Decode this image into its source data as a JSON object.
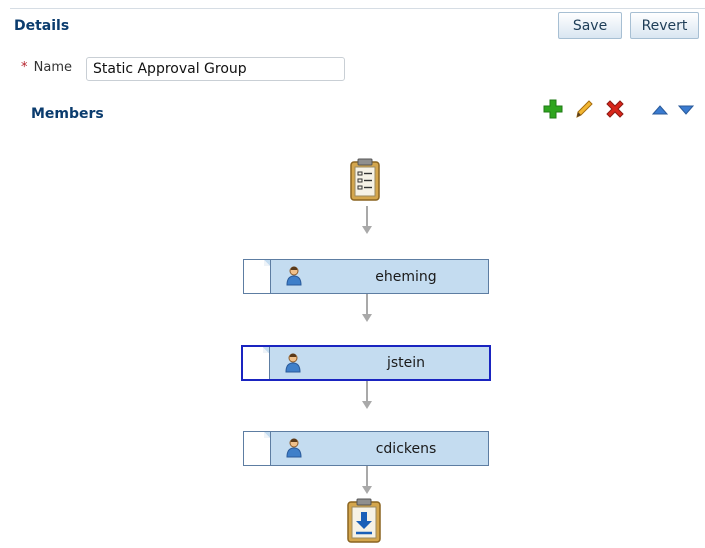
{
  "header": {
    "title": "Details",
    "save_label": "Save",
    "revert_label": "Revert"
  },
  "name_field": {
    "required_marker": "*",
    "label": "Name",
    "value": "Static Approval Group"
  },
  "members": {
    "heading": "Members",
    "toolbar_icons": [
      "add-icon",
      "edit-icon",
      "delete-icon",
      "move-up-icon",
      "move-down-icon"
    ],
    "items": [
      {
        "username": "eheming",
        "selected": false
      },
      {
        "username": "jstein",
        "selected": true
      },
      {
        "username": "cdickens",
        "selected": false
      }
    ]
  },
  "colors": {
    "heading": "#0b3c6e",
    "node_fill": "#c4dcf0",
    "node_border": "#5d7da2",
    "selected_border": "#1a24c0",
    "add": "#2fa51f",
    "delete": "#d8261b"
  }
}
